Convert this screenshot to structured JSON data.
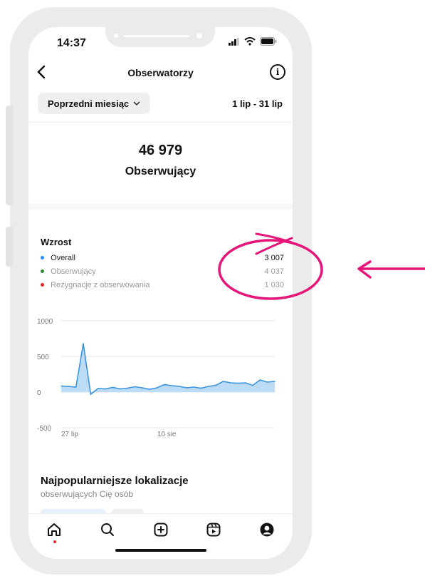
{
  "status_bar": {
    "time": "14:37"
  },
  "header": {
    "title": "Obserwatorzy",
    "back_icon": "chevron-left-icon",
    "info_icon": "info-icon"
  },
  "filter": {
    "period_label": "Poprzedni miesiąc",
    "date_range": "1 lip - 31 lip"
  },
  "summary": {
    "total": "46 979",
    "label": "Obserwujący"
  },
  "growth": {
    "title": "Wzrost",
    "legend": [
      {
        "label": "Overall",
        "value": "3 007",
        "color": "#1e90ff"
      },
      {
        "label": "Obserwujący",
        "value": "4 037",
        "color": "#2e8b3a"
      },
      {
        "label": "Rezygnacje z obserwowania",
        "value": "1 030",
        "color": "#e8262a"
      }
    ]
  },
  "chart_data": {
    "type": "area",
    "y_ticks": [
      "1000",
      "500",
      "0",
      "-500"
    ],
    "x_ticks": [
      "27 lip",
      "10 sie"
    ],
    "ylim": [
      -500,
      1000
    ],
    "series": [
      {
        "values": [
          85,
          80,
          70,
          680,
          -30,
          50,
          45,
          65,
          45,
          55,
          75,
          60,
          40,
          60,
          105,
          90,
          80,
          60,
          70,
          55,
          80,
          95,
          150,
          130,
          125,
          130,
          95,
          170,
          140,
          150
        ],
        "color": "#3b95de",
        "fill": "#bcdcf5"
      }
    ],
    "grid": true
  },
  "locations": {
    "title": "Najpopularniejsze lokalizacje",
    "subtitle": "obserwujących Cię osób"
  },
  "tabbar": {
    "icons": [
      "home-icon",
      "search-icon",
      "create-icon",
      "reels-icon",
      "profile-icon"
    ]
  },
  "annotation": {
    "color": "#e6157a"
  }
}
